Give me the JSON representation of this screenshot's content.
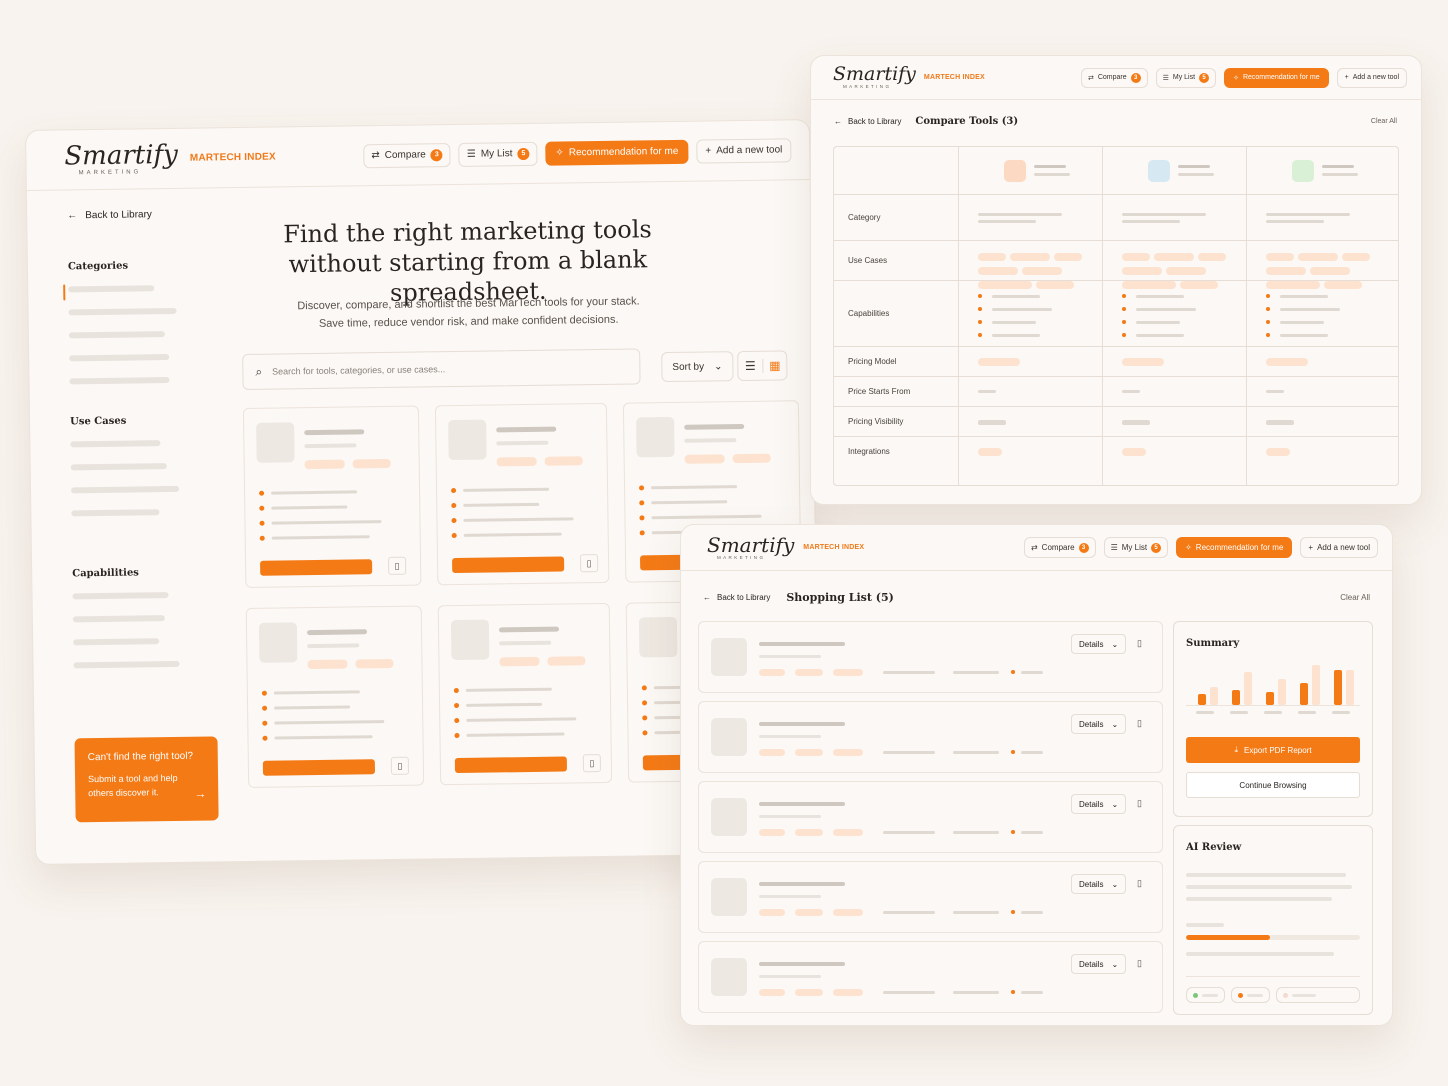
{
  "brand": {
    "logo": "Smartify",
    "logo_sub": "MARKETING",
    "index_label": "MARTECH INDEX"
  },
  "nav": {
    "compare_label": "Compare",
    "compare_count": "3",
    "mylist_label": "My List",
    "mylist_count": "5",
    "recommend_label": "Recommendation for me",
    "add_label": "Add a new tool"
  },
  "library": {
    "back_label": "Back to Library",
    "hero_title_line1": "Find the right marketing tools",
    "hero_title_line2": "without starting from a blank spreadsheet.",
    "hero_sub_line1": "Discover, compare, and shortlist the best MarTech tools for your stack.",
    "hero_sub_line2": "Save time, reduce vendor risk, and make confident decisions.",
    "search_placeholder": "Search for tools, categories, or use cases...",
    "sort_label": "Sort by",
    "sections": {
      "categories": "Categories",
      "use_cases": "Use Cases",
      "capabilities": "Capabilities"
    },
    "cta_title": "Can't find the right tool?",
    "cta_line1": "Submit a tool and help",
    "cta_line2": "others discover it."
  },
  "compare": {
    "back_label": "Back to Library",
    "title": "Compare Tools (3)",
    "clear_label": "Clear All",
    "rows": [
      "Category",
      "Use Cases",
      "Capabilities",
      "Pricing Model",
      "Price Starts From",
      "Pricing Visibility",
      "Integrations"
    ],
    "tool_colors": [
      "#fcd9c2",
      "#d6e8f2",
      "#d9efd6"
    ]
  },
  "shopping": {
    "back_label": "Back to Library",
    "title": "Shopping List (5)",
    "clear_label": "Clear All",
    "details_label": "Details",
    "summary_title": "Summary",
    "export_label": "Export PDF Report",
    "continue_label": "Continue Browsing",
    "ai_title": "AI Review",
    "summary_bars": [
      {
        "light": 0.4,
        "dark": 0.25
      },
      {
        "light": 0.75,
        "dark": 0.35
      },
      {
        "light": 0.6,
        "dark": 0.3
      },
      {
        "light": 0.9,
        "dark": 0.5
      },
      {
        "light": 0.8,
        "dark": 0.8
      }
    ],
    "ai_progress": 0.48
  },
  "colors": {
    "accent": "#f47a16",
    "bg": "#f8f3ee",
    "panel": "#fbf8f5"
  }
}
